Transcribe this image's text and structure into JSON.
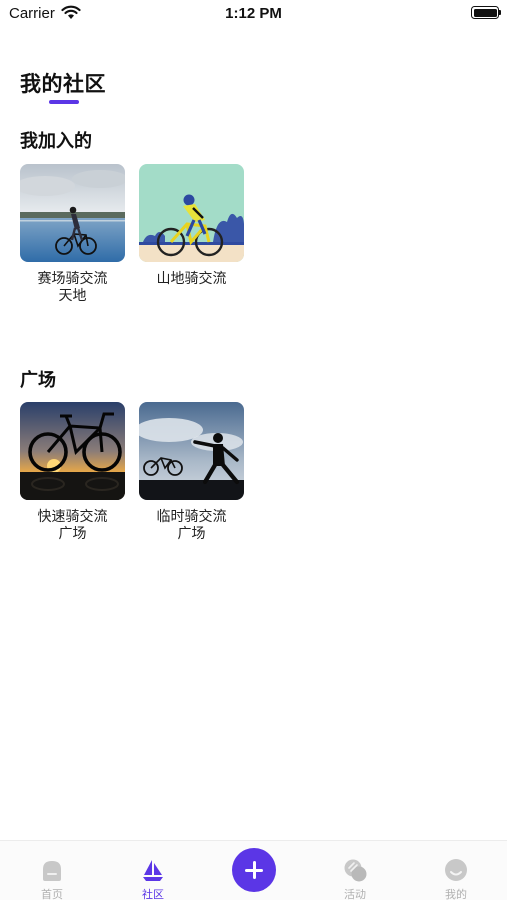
{
  "status_bar": {
    "carrier": "Carrier",
    "time": "1:12 PM"
  },
  "page_title": "我的社区",
  "joined": {
    "title": "我加入的",
    "items": [
      {
        "label": "赛场骑交流天地"
      },
      {
        "label": "山地骑交流"
      }
    ]
  },
  "square": {
    "title": "广场",
    "items": [
      {
        "label": "快速骑交流广场"
      },
      {
        "label": "临时骑交流广场"
      }
    ]
  },
  "tab_bar": {
    "tabs": [
      {
        "label": "首页",
        "icon": "home-icon"
      },
      {
        "label": "社区",
        "icon": "sailboat-icon",
        "active": true
      },
      {
        "label": "活动",
        "icon": "activity-icon"
      },
      {
        "label": "我的",
        "icon": "smile-icon"
      }
    ],
    "add_icon": "plus-icon"
  },
  "colors": {
    "accent": "#5b36e6",
    "inactive_tab": "#b0b0b0"
  }
}
